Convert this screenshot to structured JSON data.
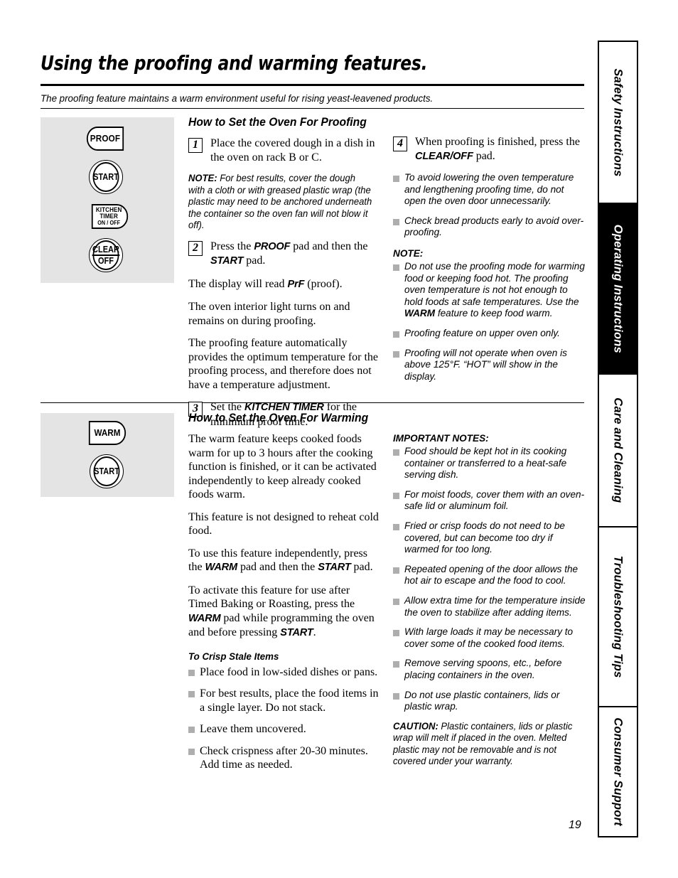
{
  "page": {
    "title": "Using the proofing and warming features.",
    "subtitle": "The proofing feature maintains a warm environment useful for rising yeast-leavened products.",
    "number": "19"
  },
  "control_panel_proofing": {
    "pads": [
      {
        "name": "proof",
        "label": "PROOF",
        "shape": "rounded-left"
      },
      {
        "name": "start",
        "label": "START",
        "shape": "circle"
      },
      {
        "name": "kitchen-timer",
        "line1": "KITCHEN",
        "line2": "TIMER",
        "line3": "ON / OFF",
        "shape": "rounded-right"
      },
      {
        "name": "clear-off",
        "line1": "CLEAR",
        "line2": "OFF",
        "shape": "circle"
      }
    ]
  },
  "control_panel_warming": {
    "pads": [
      {
        "name": "warm",
        "label": "WARM",
        "shape": "rounded-right"
      },
      {
        "name": "start",
        "label": "START",
        "shape": "circle"
      }
    ]
  },
  "proofing": {
    "heading": "How to Set the Oven For Proofing",
    "step1_num": "1",
    "step1_text": "Place the covered dough in a dish in the oven on rack B or C.",
    "note1_label": "NOTE:",
    "note1_text": " For best results, cover the dough with a cloth or with greased plastic wrap (the plastic may need to be anchored underneath the container so the oven fan will not blow it off).",
    "step2_num": "2",
    "step2_a": "Press the ",
    "step2_pad1": "PROOF",
    "step2_b": " pad and then the ",
    "step2_pad2": "START",
    "step2_c": " pad.",
    "para1_a": "The display will read ",
    "para1_pad": "PrF",
    "para1_b": " (proof).",
    "para2": "The oven interior light turns on and remains on during proofing.",
    "para3": "The proofing feature automatically provides the optimum temperature for the proofing process, and therefore does not have a temperature adjustment.",
    "step3_num": "3",
    "step3_a": "Set the ",
    "step3_pad": "KITCHEN TIMER",
    "step3_b": " for the minimum proof time."
  },
  "proofing_right": {
    "step4_num": "4",
    "step4_a": "When proofing is finished, press the ",
    "step4_pad": "CLEAR/OFF",
    "step4_b": " pad.",
    "bullets": [
      "To avoid lowering the oven temperature and lengthening proofing time, do not open the oven door unnecessarily.",
      "Check bread products early to avoid over-proofing."
    ],
    "note_label": "NOTE:",
    "note_bullets": [
      {
        "a": "Do not use the proofing mode for warming food or keeping food hot. The proofing oven temperature is not hot enough to hold foods at safe temperatures. Use the ",
        "pad": "WARM",
        "b": " feature to keep food warm."
      },
      {
        "a": "Proofing feature on upper oven only.",
        "pad": "",
        "b": ""
      },
      {
        "a": "Proofing will not operate when oven is above 125°F. “HOT” will show in the display.",
        "pad": "",
        "b": ""
      }
    ]
  },
  "warming": {
    "heading": "How to Set the Oven For Warming",
    "para1": "The warm feature keeps cooked foods warm for up to 3 hours after the cooking function is finished, or it can be activated independently to keep already cooked foods warm.",
    "para2": "This feature is not designed to reheat cold food.",
    "para3_a": "To use this feature independently, press the ",
    "para3_pad1": "WARM",
    "para3_b": " pad and then the ",
    "para3_pad2": "START",
    "para3_c": " pad.",
    "para4_a": "To activate this feature for use after Timed Baking or Roasting, press the ",
    "para4_pad1": "WARM",
    "para4_b": " pad while programming the oven and before pressing ",
    "para4_pad2": "START",
    "para4_c": ".",
    "crisp_heading": "To Crisp Stale Items",
    "crisp_bullets": [
      "Place food in low-sided dishes or pans.",
      "For best results, place the food items in a single layer. Do not stack.",
      "Leave them uncovered.",
      "Check crispness after 20-30 minutes. Add time as needed."
    ]
  },
  "warming_right": {
    "notes_label": "IMPORTANT NOTES:",
    "bullets": [
      "Food should be kept hot in its cooking container or transferred to a heat-safe serving dish.",
      "For moist foods, cover them with an oven-safe lid or aluminum foil.",
      "Fried or crisp foods do not need to be covered, but can become too dry if warmed for too long.",
      "Repeated opening of the door allows the hot air to escape and the food to cool.",
      "Allow extra time for the temperature inside the oven to stabilize after adding items.",
      "With large loads it may be necessary to cover some of the cooked food items.",
      "Remove serving spoons, etc., before placing containers in the oven.",
      "Do not use plastic containers, lids or plastic wrap."
    ],
    "caution_label": "CAUTION:",
    "caution_text": " Plastic containers, lids or plastic wrap will melt if placed in the oven. Melted plastic may not be removable and is not covered under your warranty."
  },
  "tabs": [
    {
      "label": "Safety Instructions",
      "active": false
    },
    {
      "label": "Operating Instructions",
      "active": true
    },
    {
      "label": "Care and Cleaning",
      "active": false
    },
    {
      "label": "Troubleshooting Tips",
      "active": false
    },
    {
      "label": "Consumer Support",
      "active": false
    }
  ]
}
